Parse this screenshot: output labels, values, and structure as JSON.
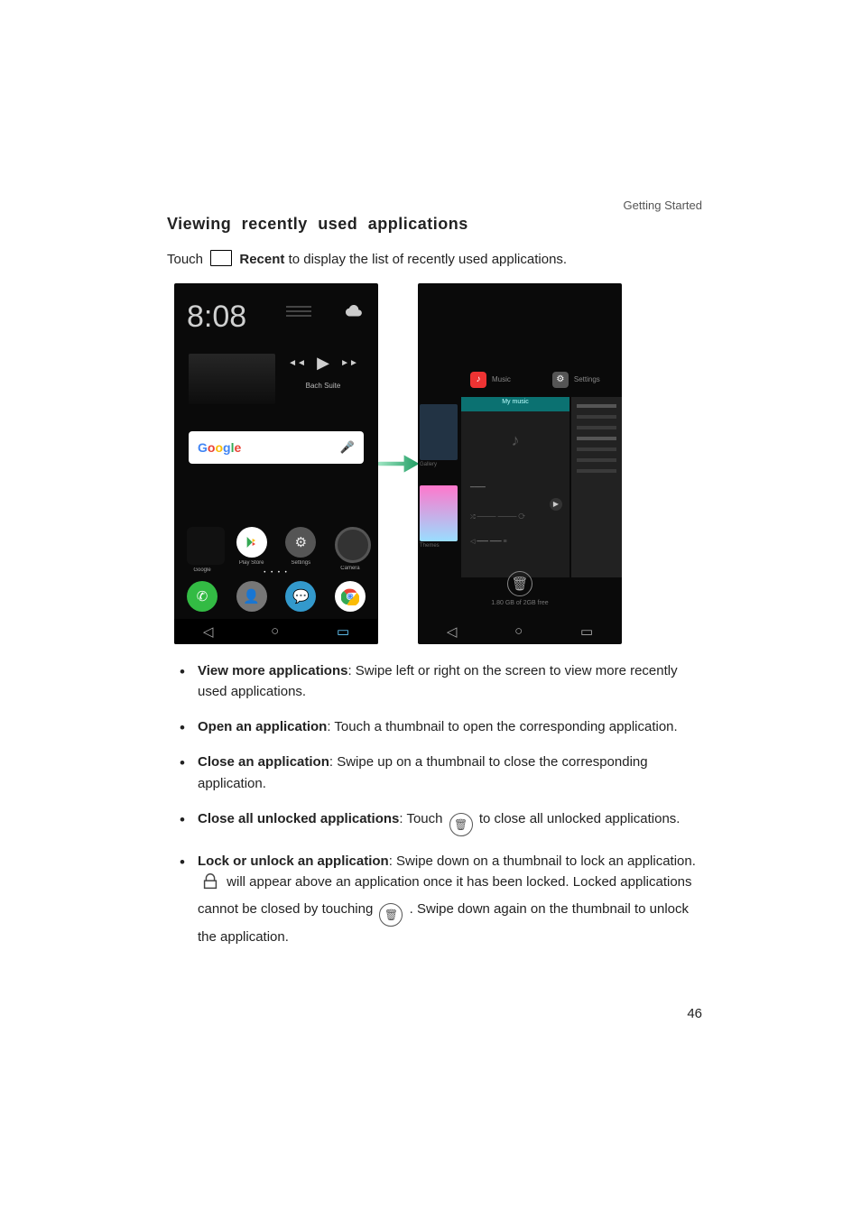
{
  "header": {
    "section": "Getting Started"
  },
  "title": "Viewing  recently  used  applications",
  "intro": {
    "pre": "Touch ",
    "keyword": "Recent",
    "post": " to display the list of recently used applications."
  },
  "figure": {
    "left_phone": {
      "time": "8:08",
      "music_track": "Bach Suite",
      "search_brand": "Google",
      "row1": [
        "Google",
        "Play Store",
        "Settings",
        "Camera"
      ],
      "row2": [
        "Phone",
        "Contacts",
        "Messaging",
        "Chrome"
      ]
    },
    "right_phone": {
      "card_labels": [
        "Music",
        "Settings"
      ],
      "center_label": "My music",
      "trash_caption": "1.80 GB of 2GB free"
    }
  },
  "bullets": [
    {
      "b": "View more applications",
      "t": ": Swipe left or right on the screen to view more recently used applications."
    },
    {
      "b": "Open an application",
      "t": ": Touch a thumbnail to open the corresponding application."
    },
    {
      "b": "Close an application",
      "t": ": Swipe up on a thumbnail to close the corresponding application."
    },
    {
      "b": "Close all unlocked applications",
      "t_before": ": Touch ",
      "t_after": " to close all unlocked applications."
    },
    {
      "b": "Lock or unlock an application",
      "t": ": Swipe down on a thumbnail to lock an application. ",
      "s1": " will appear above an application once it has been locked. Locked applications cannot be closed by touching ",
      "s2": " . Swipe down again on the thumbnail to unlock the application."
    }
  ],
  "page_number": "46"
}
